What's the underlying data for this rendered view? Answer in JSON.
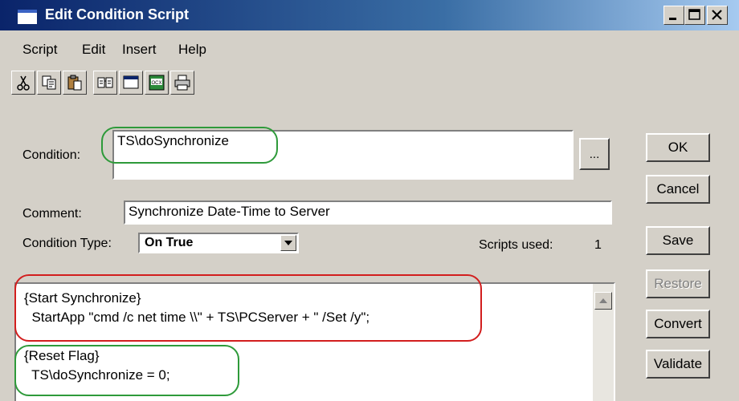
{
  "window": {
    "title": "Edit Condition Script",
    "controls": [
      "minimize-icon",
      "maximize-icon",
      "close-icon"
    ]
  },
  "menu": [
    "Script",
    "Edit",
    "Insert",
    "Help"
  ],
  "toolbar": [
    "cut-icon",
    "copy-icon",
    "paste-icon",
    "find-icon",
    "window-icon",
    "ocx-icon",
    "print-icon"
  ],
  "form": {
    "condition_label": "Condition:",
    "condition_value": "TS\\doSynchronize",
    "browse_label": "...",
    "comment_label": "Comment:",
    "comment_value": "Synchronize Date-Time to Server",
    "condition_type_label": "Condition Type:",
    "condition_type_value": "On True",
    "scripts_used_label": "Scripts used:",
    "scripts_used_value": "1"
  },
  "buttons": {
    "ok": "OK",
    "cancel": "Cancel",
    "save": "Save",
    "restore": "Restore",
    "convert": "Convert",
    "validate": "Validate"
  },
  "script_lines": [
    "{Start Synchronize}",
    "  StartApp \"cmd /c net time \\\\\" + TS\\PCServer + \" /Set /y\";",
    "",
    "{Reset Flag}",
    "  TS\\doSynchronize = 0;"
  ],
  "colors": {
    "highlight_green": "#2e9a3a",
    "highlight_red": "#d21e1e",
    "title_bar": "#0a246a"
  }
}
